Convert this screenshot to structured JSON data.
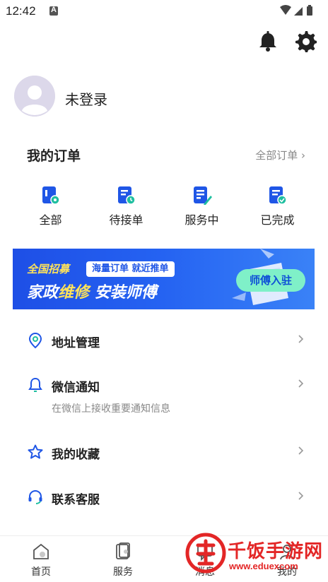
{
  "status_bar": {
    "time": "12:42"
  },
  "header_icons": {
    "notifications": "bell-icon",
    "settings": "gear-icon"
  },
  "profile": {
    "login_text": "未登录"
  },
  "orders": {
    "title": "我的订单",
    "all_link": "全部订单 ›",
    "items": [
      {
        "label": "全部",
        "icon": "order-all-icon"
      },
      {
        "label": "待接单",
        "icon": "order-pending-icon"
      },
      {
        "label": "服务中",
        "icon": "order-in-service-icon"
      },
      {
        "label": "已完成",
        "icon": "order-completed-icon"
      }
    ]
  },
  "banner": {
    "tag": "全国招募",
    "pill": "海量订单 就近推单",
    "main_part1": "家政",
    "main_highlight": "维修",
    "main_part2": " 安装师傅",
    "cta": "师傅入驻"
  },
  "menu": {
    "items": [
      {
        "label": "地址管理",
        "icon": "location-pin-icon"
      },
      {
        "label": "微信通知",
        "subtitle": "在微信上接收重要通知信息",
        "icon": "bell-outline-icon"
      },
      {
        "label": "我的收藏",
        "icon": "star-icon"
      },
      {
        "label": "联系客服",
        "icon": "headset-icon"
      }
    ]
  },
  "tab_bar": {
    "tabs": [
      {
        "label": "首页"
      },
      {
        "label": "服务"
      },
      {
        "label": "消息"
      },
      {
        "label": "我的"
      }
    ]
  },
  "watermark": {
    "brand": "千饭手游网",
    "url": "www.eduexcom"
  },
  "colors": {
    "accent": "#1f56e6",
    "banner_yellow": "#ffe35a",
    "banner_cta": "#7ff0c8",
    "watermark_red": "#e32626"
  }
}
